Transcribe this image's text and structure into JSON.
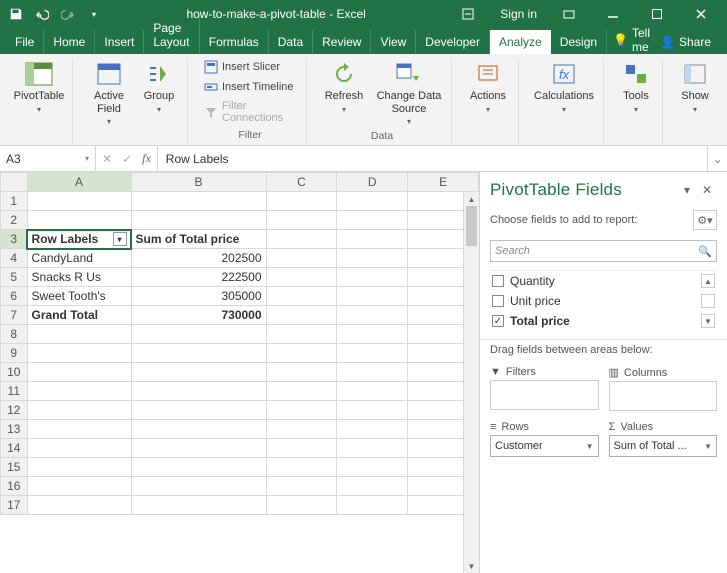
{
  "titlebar": {
    "title": "how-to-make-a-pivot-table - Excel",
    "signin": "Sign in"
  },
  "tabs": {
    "file": "File",
    "home": "Home",
    "insert": "Insert",
    "page_layout": "Page Layout",
    "formulas": "Formulas",
    "data": "Data",
    "review": "Review",
    "view": "View",
    "developer": "Developer",
    "analyze": "Analyze",
    "design": "Design",
    "tellme": "Tell me",
    "share": "Share"
  },
  "ribbon": {
    "pivottable": "PivotTable",
    "active_field": "Active Field",
    "group": "Group",
    "insert_slicer": "Insert Slicer",
    "insert_timeline": "Insert Timeline",
    "filter_connections": "Filter Connections",
    "filter_group": "Filter",
    "refresh": "Refresh",
    "change_data_source": "Change Data Source",
    "data_group": "Data",
    "actions": "Actions",
    "calculations": "Calculations",
    "tools": "Tools",
    "show": "Show"
  },
  "formula_bar": {
    "name_box": "A3",
    "formula": "Row Labels"
  },
  "grid": {
    "cols": [
      "A",
      "B",
      "C",
      "D",
      "E"
    ],
    "header_a": "Row Labels",
    "header_b": "Sum of Total price",
    "rows": [
      {
        "label": "CandyLand",
        "value": "202500"
      },
      {
        "label": "Snacks R Us",
        "value": "222500"
      },
      {
        "label": "Sweet Tooth's",
        "value": "305000"
      }
    ],
    "total_label": "Grand Total",
    "total_value": "730000"
  },
  "pane": {
    "title": "PivotTable Fields",
    "subtitle": "Choose fields to add to report:",
    "search_placeholder": "Search",
    "fields": [
      {
        "name": "Quantity",
        "checked": false
      },
      {
        "name": "Unit price",
        "checked": false
      },
      {
        "name": "Total price",
        "checked": true
      }
    ],
    "drag_label": "Drag fields between areas below:",
    "area_filters": "Filters",
    "area_columns": "Columns",
    "area_rows": "Rows",
    "area_values": "Values",
    "rows_value": "Customer",
    "values_value": "Sum of Total ..."
  },
  "chart_data": {
    "type": "table",
    "title": "Sum of Total price by Customer (PivotTable)",
    "categories": [
      "CandyLand",
      "Snacks R Us",
      "Sweet Tooth's"
    ],
    "values": [
      202500,
      222500,
      305000
    ],
    "total": 730000,
    "row_field": "Customer",
    "value_field": "Sum of Total price"
  }
}
